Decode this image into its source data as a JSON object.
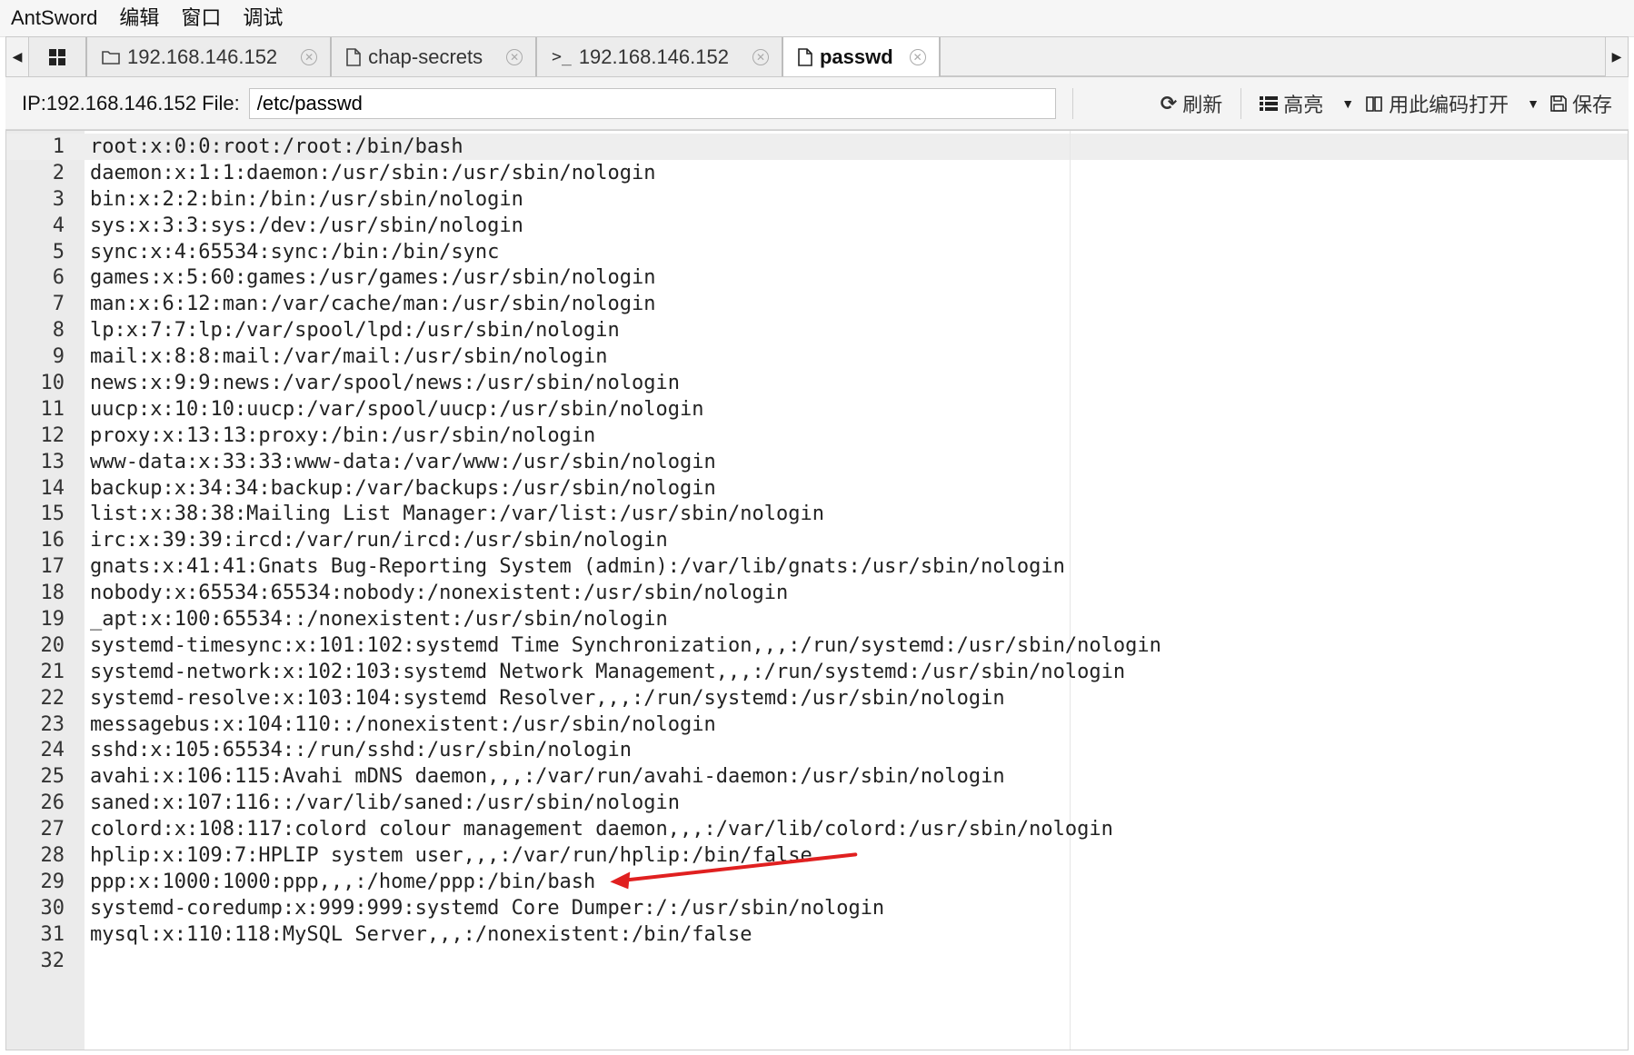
{
  "menu": [
    "AntSword",
    "编辑",
    "窗口",
    "调试"
  ],
  "tabs": [
    {
      "label": "192.168.146.152",
      "icon": "folder-icon"
    },
    {
      "label": "chap-secrets",
      "icon": "file-icon"
    },
    {
      "label": "192.168.146.152",
      "icon": "terminal-icon"
    },
    {
      "label": "passwd",
      "icon": "file-icon",
      "active": true
    }
  ],
  "toolbar": {
    "prefix": "IP:192.168.146.152 File:",
    "path_value": "/etc/passwd",
    "refresh_label": "刷新",
    "highlight_label": "高亮",
    "encoding_label": "用此编码打开",
    "save_label": "保存"
  },
  "editor": {
    "lines": [
      "root:x:0:0:root:/root:/bin/bash",
      "daemon:x:1:1:daemon:/usr/sbin:/usr/sbin/nologin",
      "bin:x:2:2:bin:/bin:/usr/sbin/nologin",
      "sys:x:3:3:sys:/dev:/usr/sbin/nologin",
      "sync:x:4:65534:sync:/bin:/bin/sync",
      "games:x:5:60:games:/usr/games:/usr/sbin/nologin",
      "man:x:6:12:man:/var/cache/man:/usr/sbin/nologin",
      "lp:x:7:7:lp:/var/spool/lpd:/usr/sbin/nologin",
      "mail:x:8:8:mail:/var/mail:/usr/sbin/nologin",
      "news:x:9:9:news:/var/spool/news:/usr/sbin/nologin",
      "uucp:x:10:10:uucp:/var/spool/uucp:/usr/sbin/nologin",
      "proxy:x:13:13:proxy:/bin:/usr/sbin/nologin",
      "www-data:x:33:33:www-data:/var/www:/usr/sbin/nologin",
      "backup:x:34:34:backup:/var/backups:/usr/sbin/nologin",
      "list:x:38:38:Mailing List Manager:/var/list:/usr/sbin/nologin",
      "irc:x:39:39:ircd:/var/run/ircd:/usr/sbin/nologin",
      "gnats:x:41:41:Gnats Bug-Reporting System (admin):/var/lib/gnats:/usr/sbin/nologin",
      "nobody:x:65534:65534:nobody:/nonexistent:/usr/sbin/nologin",
      "_apt:x:100:65534::/nonexistent:/usr/sbin/nologin",
      "systemd-timesync:x:101:102:systemd Time Synchronization,,,:/run/systemd:/usr/sbin/nologin",
      "systemd-network:x:102:103:systemd Network Management,,,:/run/systemd:/usr/sbin/nologin",
      "systemd-resolve:x:103:104:systemd Resolver,,,:/run/systemd:/usr/sbin/nologin",
      "messagebus:x:104:110::/nonexistent:/usr/sbin/nologin",
      "sshd:x:105:65534::/run/sshd:/usr/sbin/nologin",
      "avahi:x:106:115:Avahi mDNS daemon,,,:/var/run/avahi-daemon:/usr/sbin/nologin",
      "saned:x:107:116::/var/lib/saned:/usr/sbin/nologin",
      "colord:x:108:117:colord colour management daemon,,,:/var/lib/colord:/usr/sbin/nologin",
      "hplip:x:109:7:HPLIP system user,,,:/var/run/hplip:/bin/false",
      "ppp:x:1000:1000:ppp,,,:/home/ppp:/bin/bash",
      "systemd-coredump:x:999:999:systemd Core Dumper:/:/usr/sbin/nologin",
      "mysql:x:110:118:MySQL Server,,,:/nonexistent:/bin/false",
      ""
    ]
  },
  "annotation": {
    "points_to_line": 29,
    "color": "#e02020"
  }
}
